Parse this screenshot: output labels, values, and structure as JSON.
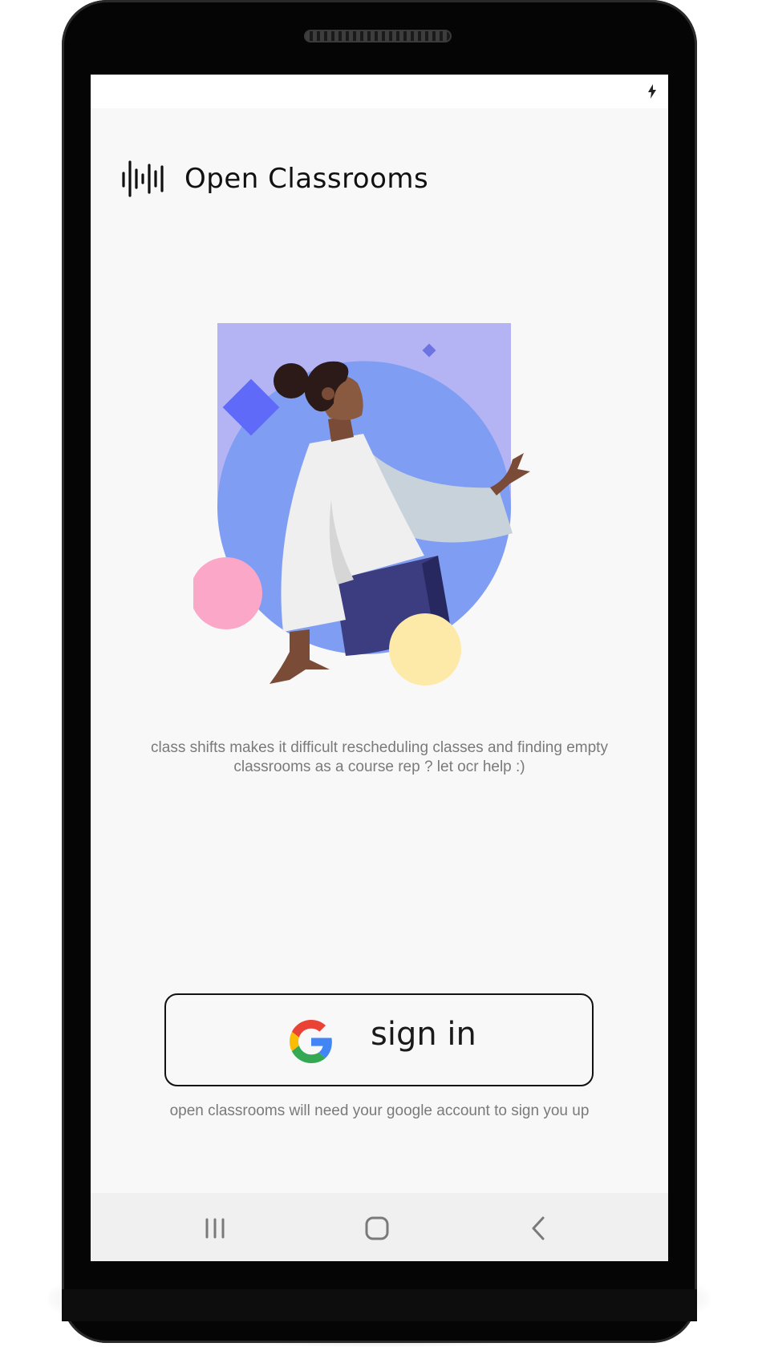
{
  "status_bar": {
    "icons": [
      "charging-bolt-icon"
    ]
  },
  "app": {
    "title": "Open Classrooms",
    "logo_icon": "waveform-logo-icon"
  },
  "illustration": {
    "subject": "person-pointing-illustration",
    "colors": {
      "background_rect": "#b4b4f4",
      "circle": "#7f9ef3",
      "pink_circle": "#fba8c8",
      "yellow_circle": "#fde9a8",
      "blue_diamond": "#5f6bf8"
    }
  },
  "main": {
    "tagline_line1": "class shifts makes it difficult rescheduling classes and finding empty",
    "tagline_line2": "classrooms as a course rep ? let ocr help :)"
  },
  "signin": {
    "button_label": "sign in",
    "icon": "google-icon",
    "note": "open classrooms will need your google account to sign you up"
  },
  "nav_bar": {
    "buttons": [
      "recents-icon",
      "home-icon",
      "back-icon"
    ]
  }
}
